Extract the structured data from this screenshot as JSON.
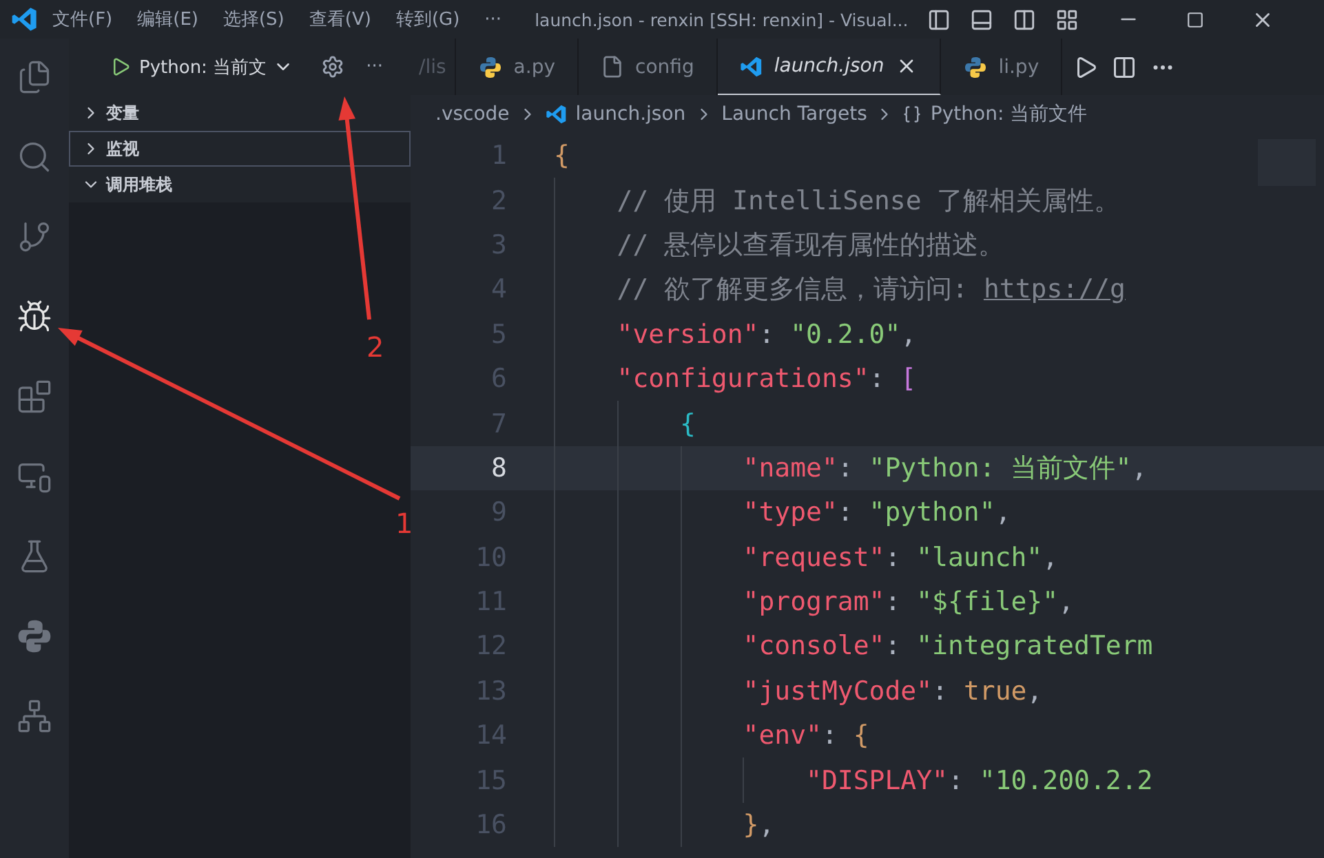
{
  "title_bar": {
    "menus": [
      "文件(F)",
      "编辑(E)",
      "选择(S)",
      "查看(V)",
      "转到(G)",
      "···"
    ],
    "title": "launch.json - renxin [SSH: renxin] - Visual..."
  },
  "activity_bar": [
    {
      "kind": "files",
      "selected": false
    },
    {
      "kind": "search",
      "selected": false
    },
    {
      "kind": "git",
      "selected": false
    },
    {
      "kind": "debug",
      "selected": true
    },
    {
      "kind": "extensions",
      "selected": false
    },
    {
      "kind": "remote",
      "selected": false
    },
    {
      "kind": "testing",
      "selected": false
    },
    {
      "kind": "python",
      "selected": false
    },
    {
      "kind": "tree",
      "selected": false
    }
  ],
  "debug_toolbar": {
    "configuration": "Python: 当前文",
    "more": "···"
  },
  "sidebar": {
    "sections": [
      {
        "label": "变量",
        "expanded": false,
        "focused": false
      },
      {
        "label": "监视",
        "expanded": false,
        "focused": true
      },
      {
        "label": "调用堆栈",
        "expanded": true,
        "focused": false
      }
    ]
  },
  "tabs": [
    {
      "label": "/lis",
      "kind": "hidden",
      "selected": false
    },
    {
      "label": "a.py",
      "kind": "python",
      "selected": false
    },
    {
      "label": "config",
      "kind": "file",
      "selected": false
    },
    {
      "label": "launch.json",
      "kind": "vscode",
      "selected": true
    },
    {
      "label": "li.py",
      "kind": "python",
      "selected": false
    }
  ],
  "breadcrumb": [
    {
      "label": ".vscode",
      "kind": "text"
    },
    {
      "label": "launch.json",
      "kind": "vscode"
    },
    {
      "label": "Launch Targets",
      "kind": "text"
    },
    {
      "label": "Python: 当前文件",
      "kind": "object"
    }
  ],
  "editor": {
    "lines": [
      {
        "number": "1",
        "current": false,
        "tokens": [
          {
            "kind": "brace",
            "text": "{"
          }
        ]
      },
      {
        "number": "2",
        "current": false,
        "tokens": [
          {
            "kind": "comment",
            "text": "    // 使用 IntelliSense 了解相关属性。"
          }
        ]
      },
      {
        "number": "3",
        "current": false,
        "tokens": [
          {
            "kind": "comment",
            "text": "    // 悬停以查看现有属性的描述。"
          }
        ]
      },
      {
        "number": "4",
        "current": false,
        "tokens": [
          {
            "kind": "comment",
            "text": "    // 欲了解更多信息，请访问: "
          },
          {
            "kind": "link",
            "text": "https://g"
          }
        ]
      },
      {
        "number": "5",
        "current": false,
        "tokens": [
          {
            "kind": "key",
            "text": "    \"version\""
          },
          {
            "kind": "punct",
            "text": ": "
          },
          {
            "kind": "string",
            "text": "\"0.2.0\""
          },
          {
            "kind": "punct",
            "text": ","
          }
        ]
      },
      {
        "number": "6",
        "current": false,
        "tokens": [
          {
            "kind": "key",
            "text": "    \"configurations\""
          },
          {
            "kind": "punct",
            "text": ": "
          },
          {
            "kind": "bracket",
            "text": "["
          }
        ]
      },
      {
        "number": "7",
        "current": false,
        "tokens": [
          {
            "kind": "nested",
            "text": "        {"
          }
        ]
      },
      {
        "number": "8",
        "current": true,
        "tokens": [
          {
            "kind": "key",
            "text": "            \"name\""
          },
          {
            "kind": "punct",
            "text": ": "
          },
          {
            "kind": "string",
            "text": "\"Python: 当前文件\""
          },
          {
            "kind": "punct",
            "text": ","
          }
        ]
      },
      {
        "number": "9",
        "current": false,
        "tokens": [
          {
            "kind": "key",
            "text": "            \"type\""
          },
          {
            "kind": "punct",
            "text": ": "
          },
          {
            "kind": "string",
            "text": "\"python\""
          },
          {
            "kind": "punct",
            "text": ","
          }
        ]
      },
      {
        "number": "10",
        "current": false,
        "tokens": [
          {
            "kind": "key",
            "text": "            \"request\""
          },
          {
            "kind": "punct",
            "text": ": "
          },
          {
            "kind": "string",
            "text": "\"launch\""
          },
          {
            "kind": "punct",
            "text": ","
          }
        ]
      },
      {
        "number": "11",
        "current": false,
        "tokens": [
          {
            "kind": "key",
            "text": "            \"program\""
          },
          {
            "kind": "punct",
            "text": ": "
          },
          {
            "kind": "string",
            "text": "\"${file}\""
          },
          {
            "kind": "punct",
            "text": ","
          }
        ]
      },
      {
        "number": "12",
        "current": false,
        "tokens": [
          {
            "kind": "key",
            "text": "            \"console\""
          },
          {
            "kind": "punct",
            "text": ": "
          },
          {
            "kind": "string",
            "text": "\"integratedTerm"
          }
        ]
      },
      {
        "number": "13",
        "current": false,
        "tokens": [
          {
            "kind": "key",
            "text": "            \"justMyCode\""
          },
          {
            "kind": "punct",
            "text": ": "
          },
          {
            "kind": "literal",
            "text": "true"
          },
          {
            "kind": "punct",
            "text": ","
          }
        ]
      },
      {
        "number": "14",
        "current": false,
        "tokens": [
          {
            "kind": "key",
            "text": "            \"env\""
          },
          {
            "kind": "punct",
            "text": ": "
          },
          {
            "kind": "brace",
            "text": "{"
          }
        ]
      },
      {
        "number": "15",
        "current": false,
        "tokens": [
          {
            "kind": "key",
            "text": "                \"DISPLAY\""
          },
          {
            "kind": "punct",
            "text": ": "
          },
          {
            "kind": "string",
            "text": "\"10.200.2.2"
          }
        ]
      },
      {
        "number": "16",
        "current": false,
        "tokens": [
          {
            "kind": "brace",
            "text": "            }"
          },
          {
            "kind": "punct",
            "text": ","
          }
        ]
      }
    ]
  },
  "annotations": [
    {
      "label": "1"
    },
    {
      "label": "2"
    }
  ]
}
